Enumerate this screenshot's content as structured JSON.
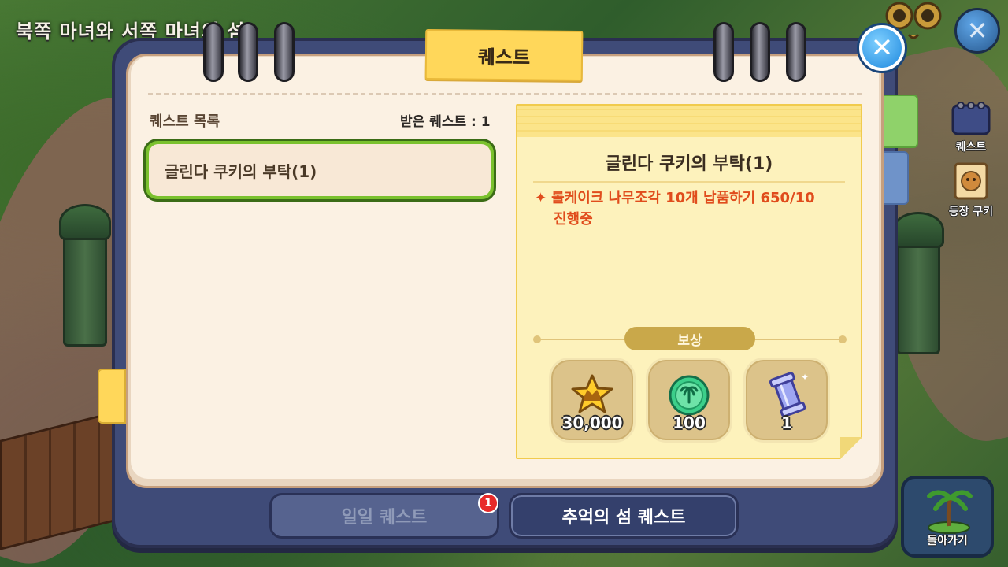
{
  "location": {
    "title": "북쪽 마녀와 서쪽 마녀의 섬"
  },
  "window": {
    "title": "퀘스트",
    "close_icon": "close-icon"
  },
  "quest_list": {
    "header": "퀘스트 목록",
    "received_label": "받은 퀘스트 : 1",
    "items": [
      {
        "label": "글린다 쿠키의 부탁(1)",
        "selected": true
      }
    ]
  },
  "detail": {
    "title": "글린다 쿠키의 부탁(1)",
    "objective": "롤케이크 나무조각 10개 납품하기 650/10",
    "status": "진행중",
    "reward_label": "보상",
    "rewards": [
      {
        "icon": "xp-star-icon",
        "amount": "30,000"
      },
      {
        "icon": "palm-coin-icon",
        "amount": "100"
      },
      {
        "icon": "crystal-pillar-icon",
        "amount": "1"
      }
    ]
  },
  "tabs": {
    "daily": {
      "label": "일일 퀘스트",
      "badge": "1"
    },
    "island": {
      "label": "추억의 섬 퀘스트",
      "active": true
    }
  },
  "hud": {
    "quest_label": "퀘스트",
    "cookie_label": "등장 쿠키",
    "return_label": "돌아가기"
  },
  "colors": {
    "frame": "#3f4b78",
    "paper": "#fbf1e3",
    "title_tag": "#ffd75a",
    "selected_border": "#7bc12e",
    "objective_text": "#e04c1c",
    "detail_bg": "#fdf2bc"
  }
}
